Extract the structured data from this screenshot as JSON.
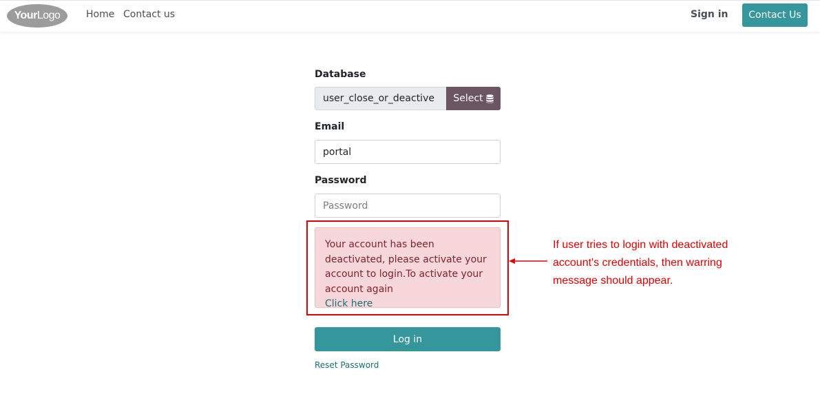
{
  "navbar": {
    "logo_bold": "Your",
    "logo_light": "Logo",
    "links": [
      {
        "label": "Home"
      },
      {
        "label": "Contact us"
      }
    ],
    "sign_in": "Sign in",
    "contact_button": "Contact Us"
  },
  "form": {
    "database_label": "Database",
    "database_value": "user_close_or_deactive",
    "select_label": "Select",
    "select_icon": "database-icon",
    "email_label": "Email",
    "email_value": "portal",
    "password_label": "Password",
    "password_placeholder": "Password",
    "alert": {
      "message": "Your account has been deactivated, please activate your account to login.To activate your account again",
      "link": "Click here"
    },
    "login_button": "Log in",
    "reset_link": "Reset Password"
  },
  "annotation": {
    "text": "If user tries to login with deactivated account's credentials, then warring message should appear."
  },
  "colors": {
    "primary": "#35979c",
    "select_bg": "#6c5563",
    "alert_bg": "#f8d7da",
    "annotation": "#e00000"
  }
}
